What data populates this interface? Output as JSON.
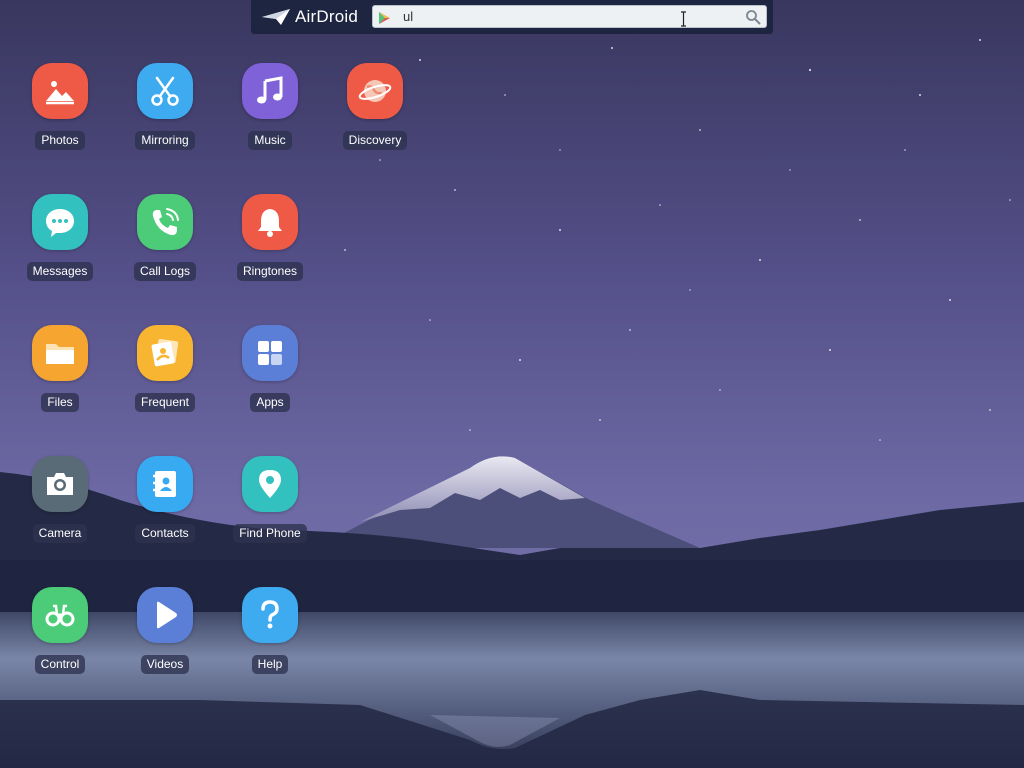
{
  "topbar": {
    "brand": "AirDroid",
    "search_value": "ul",
    "search_placeholder": ""
  },
  "apps": [
    {
      "label": "Photos",
      "icon": "photos-icon",
      "color": "#ef5a47"
    },
    {
      "label": "Mirroring",
      "icon": "mirroring-icon",
      "color": "#3eaaf0"
    },
    {
      "label": "Music",
      "icon": "music-icon",
      "color": "#7f61d8"
    },
    {
      "label": "Discovery",
      "icon": "discovery-icon",
      "color": "#ef5a47"
    },
    {
      "label": "Messages",
      "icon": "messages-icon",
      "color": "#33c1bf"
    },
    {
      "label": "Call Logs",
      "icon": "call-logs-icon",
      "color": "#4ccb78"
    },
    {
      "label": "Ringtones",
      "icon": "ringtones-icon",
      "color": "#ef5a47"
    },
    {
      "label": "Files",
      "icon": "files-icon",
      "color": "#f6a531"
    },
    {
      "label": "Frequent",
      "icon": "frequent-icon",
      "color": "#f7b531"
    },
    {
      "label": "Apps",
      "icon": "apps-icon",
      "color": "#5b7fd6"
    },
    {
      "label": "Camera",
      "icon": "camera-icon",
      "color": "#5a6b78"
    },
    {
      "label": "Contacts",
      "icon": "contacts-icon",
      "color": "#38aaf2"
    },
    {
      "label": "Find Phone",
      "icon": "find-phone-icon",
      "color": "#33c1bf"
    },
    {
      "label": "Control",
      "icon": "control-icon",
      "color": "#4ccb78"
    },
    {
      "label": "Videos",
      "icon": "videos-icon",
      "color": "#5b7fd6"
    },
    {
      "label": "Help",
      "icon": "help-icon",
      "color": "#3eaaf0"
    }
  ]
}
